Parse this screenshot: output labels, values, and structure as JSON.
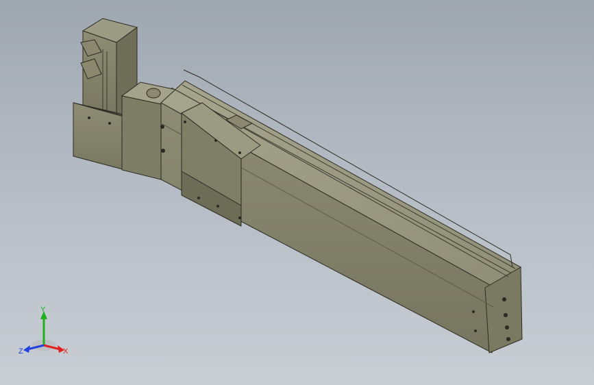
{
  "viewport": {
    "background_top": "#9ea6b0",
    "background_bottom": "#c9ced5"
  },
  "model": {
    "body_color": "#87866e",
    "shadow_color": "#6f6e58",
    "highlight_color": "#a3a28a"
  },
  "triad": {
    "x_label": "X",
    "y_label": "Y",
    "z_label": "Z",
    "x_color": "#e02020",
    "y_color": "#20b020",
    "z_color": "#2040e0"
  }
}
